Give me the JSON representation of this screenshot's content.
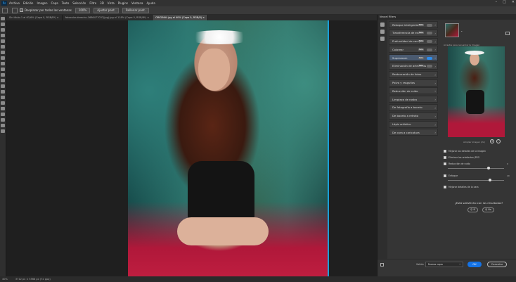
{
  "menu": {
    "logo": "Ps",
    "items": [
      "Archivo",
      "Edición",
      "Imagen",
      "Capa",
      "Texto",
      "Selección",
      "Filtro",
      "3D",
      "Vista",
      "Plugins",
      "Ventana",
      "Ayuda"
    ],
    "window_controls": [
      "–",
      "□",
      "✕"
    ]
  },
  "options": {
    "scroll_all_label": "Desplazar por todas las ventanas",
    "zoom_value": "100%",
    "fit_screen_label": "Ajustar pant.",
    "fill_screen_label": "Rellenar pant."
  },
  "tabs": [
    {
      "label": "Sin título-1 al 63,6% (Capa 0, RGB/8*) ×",
      "active": false
    },
    {
      "label": "fotocolor-derecho-1686477037(jpg).jpg al 118% (Capa 0, RGB/8*) ×",
      "active": false
    },
    {
      "label": "ORIGINAL.jpg al 40% (Capa 0, RGB/8) ×",
      "active": true
    }
  ],
  "status": {
    "zoom": "40%",
    "doc_info": "3712 px × 5568 px (72 ppp)"
  },
  "panel": {
    "title": "Neural Filters",
    "filters": [
      {
        "label": "Retoque inteligente",
        "tag": "Beta",
        "on": false
      },
      {
        "label": "Transferencia de estilo",
        "tag": "Beta",
        "on": false
      },
      {
        "label": "Profundidad de campo",
        "tag": "Beta",
        "on": false
      },
      {
        "label": "Colorear",
        "tag": "Beta",
        "on": false
      },
      {
        "label": "Superzoom",
        "tag": "Beta",
        "on": true
      },
      {
        "label": "Eliminación de artefactos",
        "tag": "Beta",
        "on": false
      },
      {
        "label": "Restauración de fotos",
        "tag": "",
        "on": null
      },
      {
        "label": "Polvo y rasguños",
        "tag": "",
        "on": null
      },
      {
        "label": "Reducción de ruido",
        "tag": "",
        "on": null
      },
      {
        "label": "Limpieza de rostro",
        "tag": "",
        "on": null
      },
      {
        "label": "De fotografía a boceto",
        "tag": "",
        "on": null
      },
      {
        "label": "De boceto a retrato",
        "tag": "",
        "on": null
      },
      {
        "label": "Lápiz artístico",
        "tag": "",
        "on": null
      },
      {
        "label": "De cara a caricatura",
        "tag": "",
        "on": null
      }
    ],
    "hint": "Arrastre para recuadrar la imagen",
    "zoom_label": "Ampliar imagen (2x)",
    "zoom_in": "+",
    "zoom_out": "−",
    "options": {
      "enhance_details": "Mejorar los detalles de la imagen",
      "remove_artifacts": "Eliminar los artefactos JPEG",
      "noise_label": "Reducción de ruido",
      "noise_value": "0",
      "noise_level": 0.7,
      "sharpen_label": "Enfoque",
      "sharpen_value": "20",
      "sharpen_level": 0.72,
      "face_details": "Mejorar detalles de la cara"
    },
    "satisfied_question": "¿Está satisfecho con los resultados?",
    "yes_label": "Sí",
    "no_label": "No",
    "footer": {
      "output_label": "Salida",
      "output_value": "Nueva capa",
      "ok_label": "OK",
      "cancel_label": "Cancelar"
    }
  }
}
